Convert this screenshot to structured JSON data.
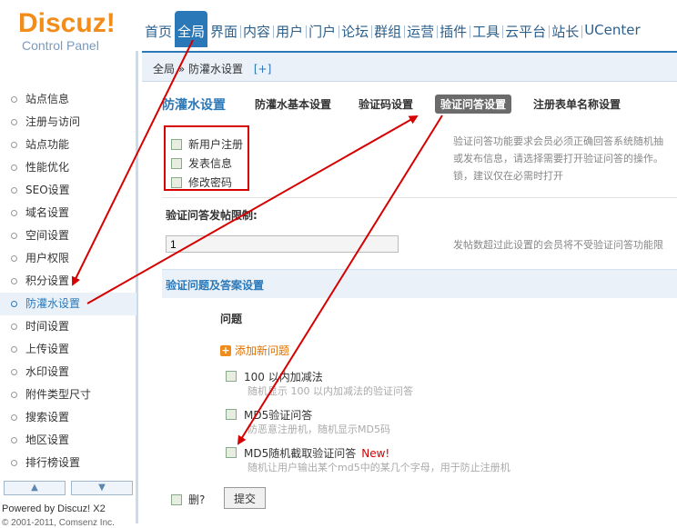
{
  "header": {
    "logo_text": "Discuz!",
    "logo_sub": "Control Panel",
    "nav": [
      "首页",
      "全局",
      "界面",
      "内容",
      "用户",
      "门户",
      "论坛",
      "群组",
      "运营",
      "插件",
      "工具",
      "云平台",
      "站长",
      "UCenter"
    ],
    "active_nav": "全局"
  },
  "breadcrumb": {
    "root": "全局",
    "sep": "»",
    "current": "防灌水设置",
    "plus": "[+]"
  },
  "sidebar": {
    "items": [
      "站点信息",
      "注册与访问",
      "站点功能",
      "性能优化",
      "SEO设置",
      "域名设置",
      "空间设置",
      "用户权限",
      "积分设置",
      "防灌水设置",
      "时间设置",
      "上传设置",
      "水印设置",
      "附件类型尺寸",
      "搜索设置",
      "地区设置",
      "排行榜设置"
    ],
    "active": "防灌水设置",
    "scroll_up": "▲",
    "scroll_down": "▼",
    "powered_by": "Powered by Discuz! X2",
    "copyright": "© 2001-2011, Comsenz Inc."
  },
  "tabs": {
    "title": "防灌水设置",
    "items": [
      "防灌水基本设置",
      "验证码设置",
      "验证问答设置",
      "注册表单名称设置"
    ],
    "active": "验证问答设置"
  },
  "checkboxes": [
    "新用户注册",
    "发表信息",
    "修改密码"
  ],
  "description1": [
    "验证问答功能要求会员必须正确回答系统随机抽",
    "或发布信息，请选择需要打开验证问答的操作。",
    "锁，建议仅在必需时打开"
  ],
  "post_limit": {
    "label": "验证问答发帖限制:",
    "value": "1",
    "description": "发帖数超过此设置的会员将不受验证问答功能限"
  },
  "section": {
    "title": "验证问题及答案设置",
    "column_header": "问题",
    "add_label": "添加新问题",
    "questions": [
      {
        "title": "100 以内加减法",
        "desc": "随机显示 100 以内加减法的验证问答",
        "new": ""
      },
      {
        "title": "MD5验证问答",
        "desc": "防恶意注册机，随机显示MD5码",
        "new": ""
      },
      {
        "title": "MD5随机截取验证问答",
        "desc": "随机让用户输出某个md5中的某几个字母，用于防止注册机",
        "new": "New!"
      }
    ]
  },
  "footer": {
    "delete_label": "删?",
    "submit_label": "提交"
  },
  "colors": {
    "accent": "#2b78b8",
    "logo": "#f28c1b",
    "annotation": "#d60000"
  }
}
